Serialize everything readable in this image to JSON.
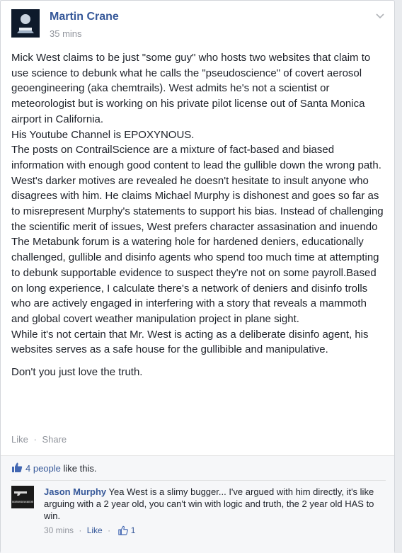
{
  "post": {
    "author": "Martin Crane",
    "time": "35 mins",
    "paragraphs": [
      "Mick West claims to be just \"some guy\" who hosts two websites that claim to use science to debunk what he calls the \"pseudoscience\" of covert aerosol geoengineering (aka chemtrails). West admits he's not a scientist or meteorologist but is working on his private pilot license out of Santa Monica airport in California.",
      "His Youtube Channel is EPOXYNOUS.",
      "The posts on ContrailScience are a mixture of fact-based and biased information with enough good content to lead the gullible down the wrong path.",
      "West's darker motives are revealed he doesn't hesitate to insult anyone who disagrees with him. He claims Michael Murphy is dishonest and goes so far as to misrepresent Murphy's statements to support his bias. Instead of challenging the scientific merit of issues, West prefers character assasination and inuendo",
      "The Metabunk forum is a watering hole for hardened deniers, educationally challenged, gullible and disinfo agents who spend too much time at attempting to debunk supportable evidence to suspect they're not on some payroll.Based on long experience, I calculate there's a network of deniers and disinfo trolls who are actively engaged in interfering with a story that reveals a mammoth and global covert weather manipulation project in plane sight.",
      "While it's not certain that Mr. West is acting as a deliberate disinfo agent, his websites serves as a safe house for the gullibible and manipulative."
    ],
    "closing": "Don't you just love the truth."
  },
  "actions": {
    "like": "Like",
    "separator": "·",
    "share": "Share"
  },
  "likes": {
    "count_text": "4 people",
    "suffix": "like this."
  },
  "comment": {
    "author": "Jason Murphy",
    "text": "Yea West is a slimy bugger... I've argued with him directly, it's like arguing with a 2 year old, you can't win with logic and truth, the 2 year old HAS to win.",
    "time": "30 mins",
    "separator": "·",
    "like": "Like",
    "like_count": "1",
    "avatar_text": "GUN CONTRO ARY ABOUT GUN IS ABOUT CONTR"
  },
  "colors": {
    "link": "#365899",
    "meta": "#90949c",
    "text": "#1d2129",
    "feedback_bg": "#f6f7f9"
  },
  "icons": [
    "chevron-down-icon",
    "thumbs-up-icon"
  ]
}
